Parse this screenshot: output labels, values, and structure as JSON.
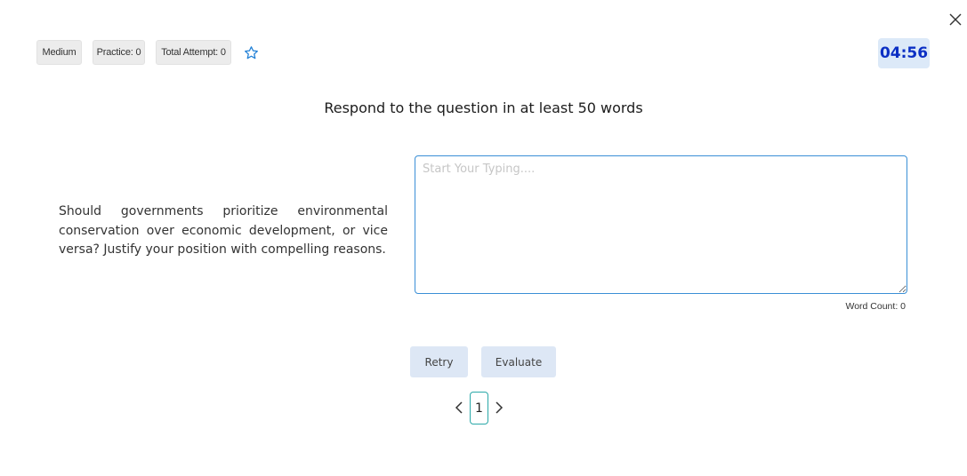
{
  "header": {
    "badges": {
      "difficulty": "Medium",
      "practice": "Practice: 0",
      "total_attempt": "Total Attempt: 0"
    },
    "timer": "04:56"
  },
  "icons": {
    "close": "close-icon",
    "favorite": "star-outline-icon",
    "prev": "chevron-left-icon",
    "next": "chevron-right-icon"
  },
  "colors": {
    "accent": "#1f7fd6",
    "timer_text": "#0b2fc4",
    "timer_bg": "#dce9f8",
    "button_bg": "#dde7f5",
    "page_border": "#2aa8a8"
  },
  "main": {
    "instruction": "Respond to the question in at least 50 words",
    "question": "Should governments prioritize environmental conservation over economic development, or vice versa? Justify your position with compelling reasons.",
    "answer": {
      "value": "",
      "placeholder": "Start Your Typing...."
    },
    "word_count": "Word Count: 0"
  },
  "actions": {
    "retry": "Retry",
    "evaluate": "Evaluate"
  },
  "pagination": {
    "current_page": "1"
  }
}
